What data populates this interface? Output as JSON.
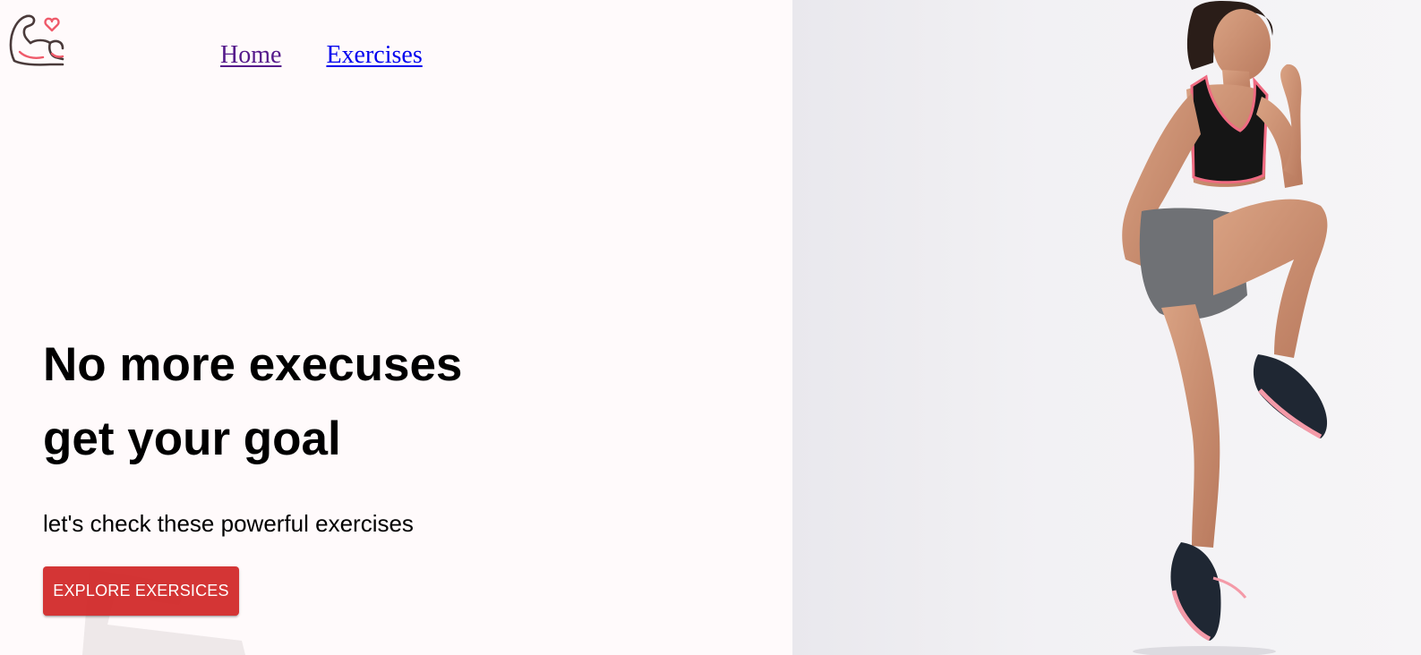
{
  "header": {
    "logo_icon": "flexed-arm-heart-icon",
    "nav": [
      {
        "label": "Home",
        "state": "visited"
      },
      {
        "label": "Exercises",
        "state": "link"
      }
    ]
  },
  "hero": {
    "title_line1": "No more execuses",
    "title_line2": "get your goal",
    "subtitle": "let's check these powerful exercises",
    "button_label": "EXPLORE EXERSICES",
    "photo_icon": "jumping-athlete-photo"
  },
  "colors": {
    "background": "#fffafb",
    "accent": "#d32f2f",
    "visited_link": "#551a8b",
    "link": "#0000ee"
  }
}
